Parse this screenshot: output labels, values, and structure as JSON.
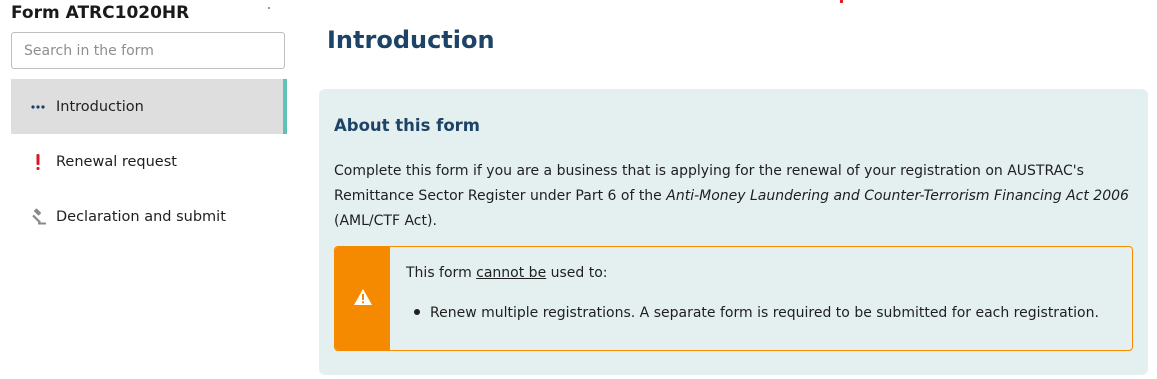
{
  "sidebar": {
    "form_title": "Form ATRC1020HR",
    "search": {
      "placeholder": "Search in the form",
      "value": ""
    },
    "items": [
      {
        "label": "Introduction",
        "icon": "ellipsis-icon",
        "state": "active"
      },
      {
        "label": "Renewal request",
        "icon": "exclamation-icon",
        "state": "error"
      },
      {
        "label": "Declaration and submit",
        "icon": "gavel-icon",
        "state": "default"
      }
    ]
  },
  "main": {
    "title": "Introduction",
    "panel": {
      "heading": "About this form",
      "text_before_italic": "Complete this form if you are a business that is applying for the renewal of your registration on AUSTRAC's Remittance Sector Register under Part 6 of the ",
      "text_italic": "Anti-Money Laundering and Counter-Terrorism Financing Act 2006",
      "text_after_italic": " (AML/CTF Act).",
      "warning": {
        "icon": "warning-triangle-icon",
        "intro_prefix": "This form ",
        "intro_underlined": "cannot be",
        "intro_suffix": " used to:",
        "items": [
          "Renew multiple registrations. A separate form is required to be submitted for each registration."
        ]
      }
    }
  },
  "colors": {
    "heading": "#1d4466",
    "panel_bg": "#e4eff0",
    "active_nav_bg": "#dedede",
    "active_accent": "#5fc2b4",
    "warning": "#f58a00",
    "error": "#d9192a"
  }
}
